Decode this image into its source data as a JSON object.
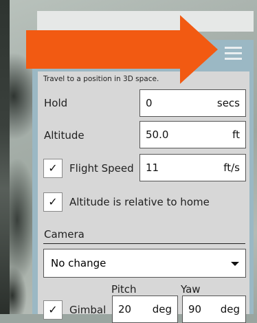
{
  "panel": {
    "description": "Travel to a position in 3D space.",
    "hold": {
      "label": "Hold",
      "value": "0",
      "unit": "secs"
    },
    "altitude": {
      "label": "Altitude",
      "value": "50.0",
      "unit": "ft"
    },
    "flight_speed": {
      "label": "Flight Speed",
      "value": "11",
      "unit": "ft/s",
      "checked": true
    },
    "relative_home": {
      "label": "Altitude is relative to home",
      "checked": true
    },
    "camera": {
      "label": "Camera",
      "selected": "No change"
    },
    "gimbal": {
      "label": "Gimbal",
      "checked": true,
      "pitch_header": "Pitch",
      "yaw_header": "Yaw",
      "pitch": {
        "value": "20",
        "unit": "deg"
      },
      "yaw": {
        "value": "90",
        "unit": "deg"
      }
    }
  },
  "check_glyph": "✓",
  "colors": {
    "arrow": "#f25a12",
    "panel_frame": "#9bb8c4",
    "panel_bg": "#d7d7d7",
    "menu_lines": "#e9eef0"
  },
  "icons": {
    "menu": "hamburger-icon",
    "dropdown": "dropdown-caret-icon",
    "pointer": "arrow-indicator-icon"
  }
}
